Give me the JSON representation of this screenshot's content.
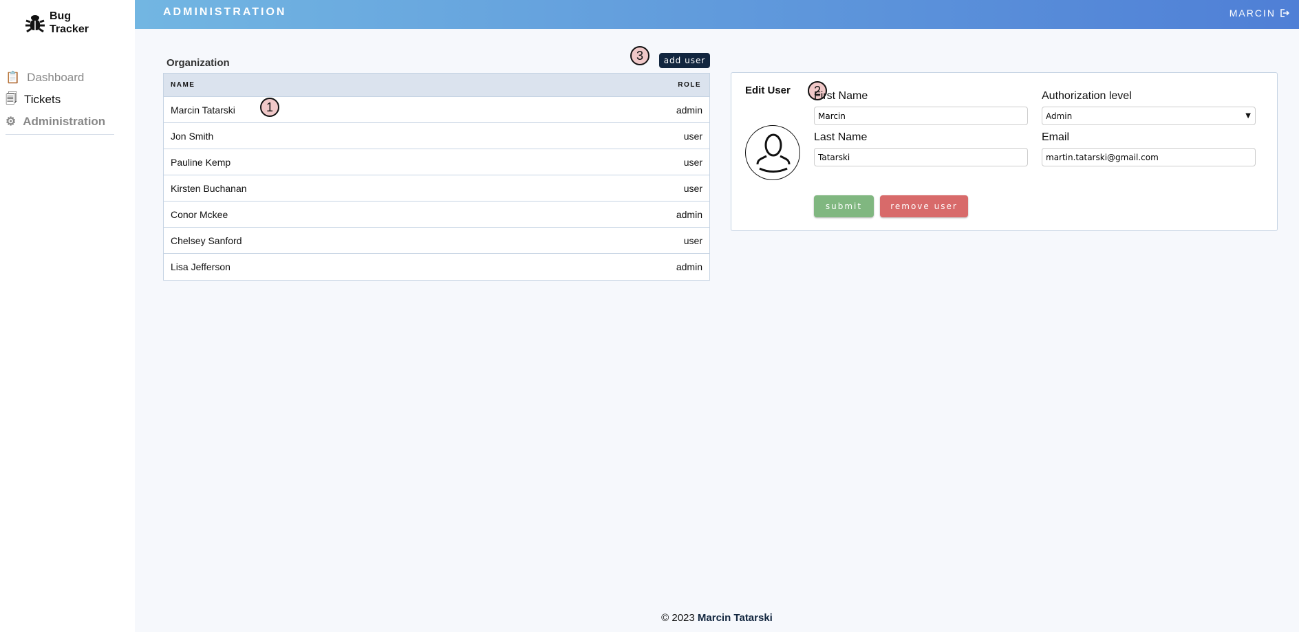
{
  "app": {
    "name_line1": "Bug",
    "name_line2": "Tracker"
  },
  "sidebar": {
    "items": [
      {
        "label": "Dashboard",
        "icon": "chart-clipboard-icon"
      },
      {
        "label": "Tickets",
        "icon": "tickets-icon"
      },
      {
        "label": "Administration",
        "icon": "gear-icon"
      }
    ]
  },
  "header": {
    "title": "ADMINISTRATION",
    "user": "MARCIN",
    "logout_icon": "logout-icon"
  },
  "organization": {
    "title": "Organization",
    "add_user": "add user",
    "columns": [
      "NAME",
      "ROLE"
    ],
    "rows": [
      {
        "name": "Marcin Tatarski",
        "role": "admin"
      },
      {
        "name": "Jon Smith",
        "role": "user"
      },
      {
        "name": "Pauline Kemp",
        "role": "user"
      },
      {
        "name": "Kirsten Buchanan",
        "role": "user"
      },
      {
        "name": "Conor Mckee",
        "role": "admin"
      },
      {
        "name": "Chelsey Sanford",
        "role": "user"
      },
      {
        "name": "Lisa Jefferson",
        "role": "admin"
      }
    ]
  },
  "annotations": [
    "1",
    "2",
    "3"
  ],
  "edit_user": {
    "title": "Edit User",
    "first_name_label": "First Name",
    "first_name": "Marcin",
    "last_name_label": "Last Name",
    "last_name": "Tatarski",
    "auth_label": "Authorization level",
    "auth_value": "Admin",
    "email_label": "Email",
    "email": "martin.tatarski@gmail.com",
    "submit": "submit",
    "remove": "remove user"
  },
  "colors": {
    "submit": "#80b780",
    "remove": "#d86a6a",
    "add_user": "#12263f"
  },
  "footer": {
    "copy": "© 2023 ",
    "author": "Marcin Tatarski"
  }
}
